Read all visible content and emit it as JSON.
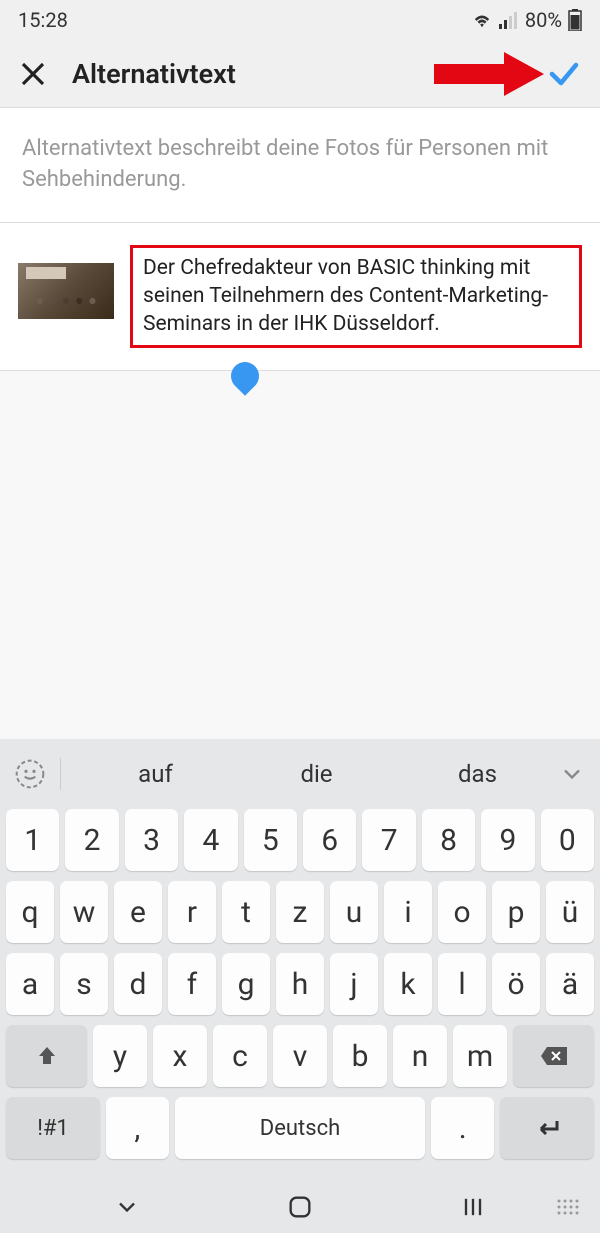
{
  "status": {
    "time": "15:28",
    "battery": "80%"
  },
  "header": {
    "title": "Alternativtext"
  },
  "description": "Alternativtext beschreibt deine Fotos für Personen mit Sehbehinderung.",
  "alt_text": "Der Chefredakteur von BASIC thinking mit seinen Teilnehmern des Content-Marketing-Seminars in der IHK Düsseldorf.",
  "keyboard": {
    "suggestions": [
      "auf",
      "die",
      "das"
    ],
    "row1": [
      "1",
      "2",
      "3",
      "4",
      "5",
      "6",
      "7",
      "8",
      "9",
      "0"
    ],
    "row2": [
      "q",
      "w",
      "e",
      "r",
      "t",
      "z",
      "u",
      "i",
      "o",
      "p",
      "ü"
    ],
    "row3": [
      "a",
      "s",
      "d",
      "f",
      "g",
      "h",
      "j",
      "k",
      "l",
      "ö",
      "ä"
    ],
    "row4": [
      "y",
      "x",
      "c",
      "v",
      "b",
      "n",
      "m"
    ],
    "symbols": "!#1",
    "comma": ",",
    "space": "Deutsch",
    "period": "."
  }
}
